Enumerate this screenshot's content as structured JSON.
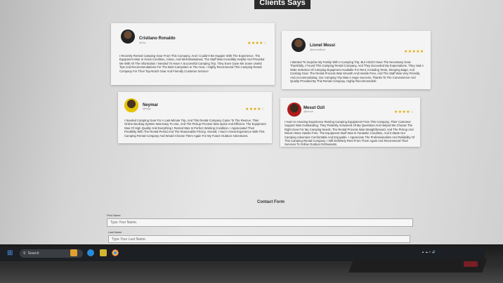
{
  "section_title": "Clients Says",
  "testimonials": [
    {
      "name": "Cristiano Ronaldo",
      "handle": "@Sss",
      "rating": 4,
      "text": "I Recently Rented Camping Gear From This Company, And I Couldn't Be Happier With The Experience. The Equipment Was In Great Condition, Clean, And Well-Maintained. The Staff Was Incredibly Helpful And Provided Me With All The Information I Needed To Have A Successful Camping Trip. They Even Gave Me Some Useful Tips And Recommendations For The Best Campsites In The Area. I Highly Recommend This Camping Rental Company For Their Top-Notch Gear And Friendly Customer Service!"
    },
    {
      "name": "Lionel Messi",
      "handle": "@lionelofficial",
      "rating": 5,
      "text": "I Wanted To Surprise My Family With A Camping Trip, But I Didn't Have The Necessary Gear. Thankfully, I Found This Camping Rental Company, And They Exceeded My Expectations. They Had A Wide Selection Of Camping Equipment Available For Rent, Including Tents, Sleeping Bags, And Cooking Gear. The Rental Process Was Smooth And Hassle-Free, And The Staff Was Very Friendly And Accommodating. Our Camping Trip Was A Huge Success, Thanks To The Convenience And Quality Provided By This Rental Company. Highly Recommended!"
    },
    {
      "name": "Neymar",
      "handle": "@Neyjr",
      "rating": 4,
      "text": "I Needed Camping Gear For A Last-Minute Trip, And This Rental Company Came To The Rescue. Their Online Booking System Was Easy To Use, And The Pickup Process Was Quick And Efficient. The Equipment Was Of High Quality And Everything I Rented Was In Perfect Working Condition. I Appreciated Their Flexibility With The Rental Period And The Reasonable Pricing. Overall, I Had A Great Experience With This Camping Rental Company And Would Choose Them Again For My Future Outdoor Adventures."
    },
    {
      "name": "Mesut Ozil",
      "handle": "@kloooe",
      "rating": 4,
      "text": "I Had An Amazing Experience Renting Camping Equipment From This Company. Their Customer Support Was Outstanding. They Patiently Answered All My Questions And Helped Me Choose The Right Gear For My Camping Needs. The Rental Process Was Straightforward, And The Pickup And Return Were Hassle-Free. The Equipment Itself Was In Fantastic Condition, And It Made Our Camping Adventure Comfortable And Enjoyable. I Appreciate The Professionalism And Reliability Of This Camping Rental Company. I Will Definitely Rent From Them Again And Recommend Their Services To Fellow Outdoor Enthusiasts."
    }
  ],
  "contact_form": {
    "title": "Contact Form",
    "first_name_label": "First Name",
    "first_name_placeholder": "Type Your Name.",
    "last_name_label": "Last Name",
    "last_name_placeholder": "Type Your Last Name."
  },
  "taskbar": {
    "search_placeholder": "Search"
  },
  "colors": {
    "star": "#e0a800",
    "taskbar": "#1c1f24",
    "header_band": "#2c2c2c"
  }
}
